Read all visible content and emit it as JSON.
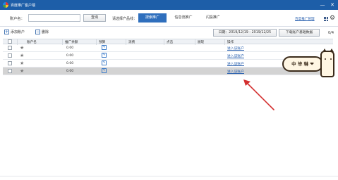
{
  "window": {
    "title": "百度推广客户端",
    "minimize_glyph": "—",
    "close_glyph": "✕"
  },
  "toolbar": {
    "account_label": "账户名：",
    "account_value": "",
    "query_button": "查询",
    "line_label": "请选择产品线：",
    "tabs": [
      {
        "label": "搜索推广",
        "active": true
      },
      {
        "label": "信息流推广",
        "active": false
      },
      {
        "label": "闪投推广",
        "active": false
      }
    ],
    "manager_link": "百度推广管理"
  },
  "actions": {
    "add_account": "添加账户",
    "delete": "删除",
    "date_range": "日期：2019/12/19 - 2019/12/25",
    "download_button": "下载账户基础数据",
    "page_count": "0/4"
  },
  "table": {
    "headers": [
      "账户名",
      "推广余额",
      "预算",
      "消费",
      "点击",
      "展现",
      "操作"
    ],
    "rows": [
      {
        "account": "",
        "balance": "0.00",
        "action": "进入该账户",
        "selected": false
      },
      {
        "account": "",
        "balance": "0.00",
        "action": "进入该账户",
        "selected": false
      },
      {
        "account": "",
        "balance": "0.00",
        "action": "进入该账户",
        "selected": false
      },
      {
        "account": "",
        "balance": "0.00",
        "action": "进入该账户",
        "selected": true
      }
    ]
  },
  "sticker": {
    "text": "中 毕 琳 ❤"
  },
  "colors": {
    "titlebar": "#1d5ea8",
    "active_tab": "#2f6fbd",
    "link": "#2d63b0",
    "arrow": "#d32f2f",
    "selected_row": "#d3d3d3"
  },
  "icons": [
    "app-logo-icon",
    "minimize-icon",
    "close-icon",
    "grid-icon",
    "gear-icon",
    "add-icon",
    "delete-icon",
    "star-icon",
    "edit-icon",
    "arrow-annotation"
  ]
}
